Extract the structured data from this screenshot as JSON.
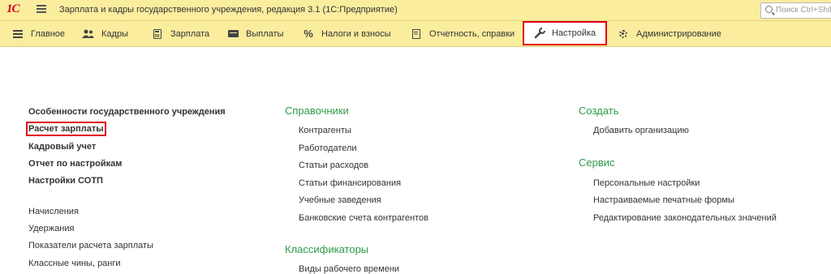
{
  "app": {
    "logo_text": "1С",
    "title": "Зарплата и кадры государственного учреждения, редакция 3.1  (1С:Предприятие)"
  },
  "search": {
    "placeholder": "Поиск Ctrl+Shift+F"
  },
  "sections": [
    {
      "label": "Главное",
      "icon": "hamburger-icon"
    },
    {
      "label": "Кадры",
      "icon": "people-icon"
    },
    {
      "label": "Зарплата",
      "icon": "calculator-icon"
    },
    {
      "label": "Выплаты",
      "icon": "wallet-icon"
    },
    {
      "label": "Налоги и взносы",
      "icon": "percent-icon"
    },
    {
      "label": "Отчетность, справки",
      "icon": "documents-icon"
    },
    {
      "label": "Настройка",
      "icon": "wrench-icon",
      "active": true
    },
    {
      "label": "Администрирование",
      "icon": "gear-icon"
    }
  ],
  "left_column": {
    "main_links": [
      "Особенности государственного учреждения",
      "Расчет зарплаты",
      "Кадровый учет",
      "Отчет по настройкам",
      "Настройки СОТП"
    ],
    "links": [
      "Начисления",
      "Удержания",
      "Показатели расчета зарплаты",
      "Классные чины, ранги"
    ]
  },
  "middle_column": {
    "directories_title": "Справочники",
    "directories": [
      "Контрагенты",
      "Работодатели",
      "Статьи расходов",
      "Статьи финансирования",
      "Учебные заведения",
      "Банковские счета контрагентов"
    ],
    "classifiers_title": "Классификаторы",
    "classifiers": [
      "Виды рабочего времени"
    ]
  },
  "right_column": {
    "create_title": "Создать",
    "create_links": [
      "Добавить организацию"
    ],
    "service_title": "Сервис",
    "service_links": [
      "Персональные настройки",
      "Настраиваемые печатные формы",
      "Редактирование законодательных значений"
    ]
  },
  "colors": {
    "panel_bg": "#fbed9e",
    "group_title": "#2f9a4a",
    "highlight_border": "#e0001a"
  }
}
